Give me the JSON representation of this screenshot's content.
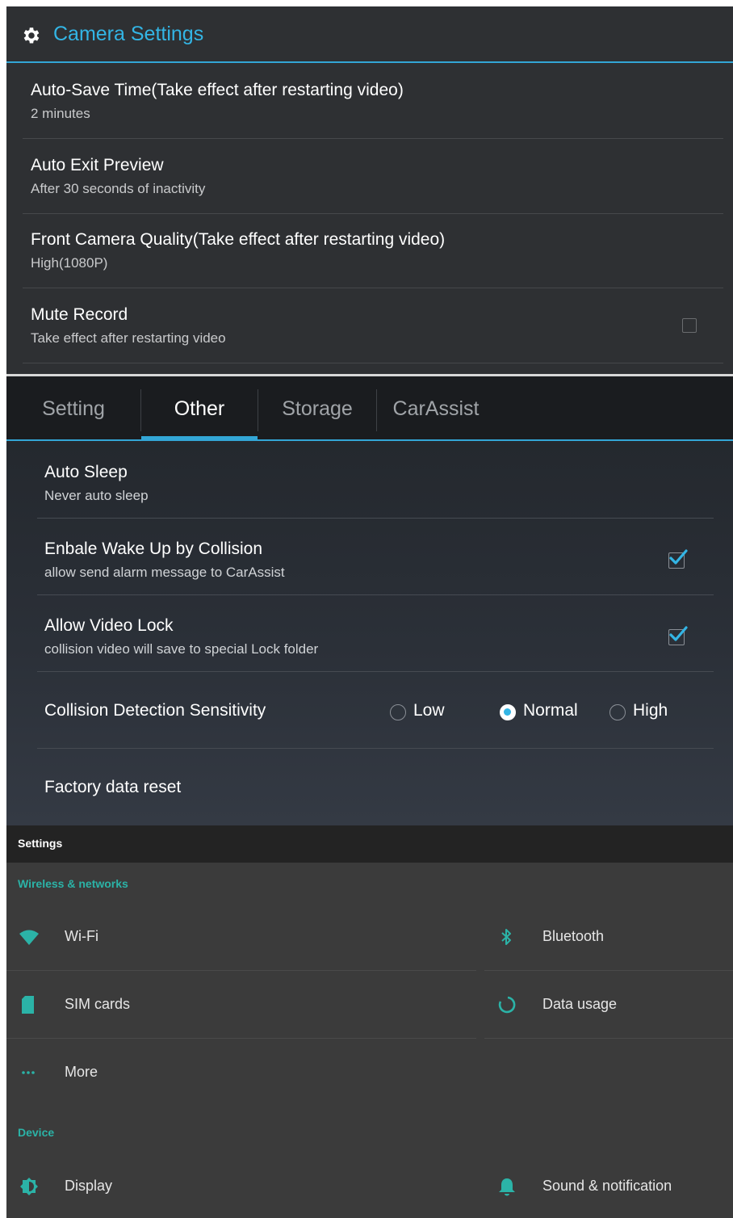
{
  "camera_settings": {
    "title": "Camera Settings",
    "icon": "gear-icon",
    "items": [
      {
        "title": "Auto-Save Time(Take effect after restarting video)",
        "summary": "2 minutes"
      },
      {
        "title": "Auto Exit Preview",
        "summary": "After 30 seconds of inactivity"
      },
      {
        "title": "Front Camera Quality(Take effect after restarting video)",
        "summary": "High(1080P)"
      },
      {
        "title": "Mute Record",
        "summary": "Take effect after restarting video",
        "checked": false
      }
    ]
  },
  "other_panel": {
    "tabs": [
      {
        "label": "Setting",
        "active": false
      },
      {
        "label": "Other",
        "active": true
      },
      {
        "label": "Storage",
        "active": false
      },
      {
        "label": "CarAssist",
        "active": false
      }
    ],
    "items": {
      "auto_sleep": {
        "title": "Auto Sleep",
        "summary": "Never auto sleep"
      },
      "wake_up": {
        "title": "Enbale Wake Up by Collision",
        "summary": "allow send alarm message to CarAssist",
        "checked": true
      },
      "video_lock": {
        "title": "Allow Video Lock",
        "summary": "collision video will save to special Lock folder",
        "checked": true
      },
      "sensitivity": {
        "title": "Collision Detection Sensitivity",
        "options": [
          "Low",
          "Normal",
          "High"
        ],
        "selected": "Normal"
      },
      "factory_reset": {
        "title": "Factory data reset"
      }
    },
    "accent_color": "#33b5e5"
  },
  "settings_app": {
    "title": "Settings",
    "accent_color": "#2bb3a7",
    "sections": [
      {
        "header": "Wireless & networks",
        "items": [
          {
            "label": "Wi-Fi",
            "icon": "wifi-icon"
          },
          {
            "label": "Bluetooth",
            "icon": "bluetooth-icon"
          },
          {
            "label": "SIM cards",
            "icon": "sim-card-icon"
          },
          {
            "label": "Data usage",
            "icon": "data-usage-icon"
          },
          {
            "label": "More",
            "icon": "more-dots-icon"
          }
        ]
      },
      {
        "header": "Device",
        "items": [
          {
            "label": "Display",
            "icon": "brightness-icon"
          },
          {
            "label": "Sound & notification",
            "icon": "bell-icon"
          }
        ]
      }
    ]
  }
}
